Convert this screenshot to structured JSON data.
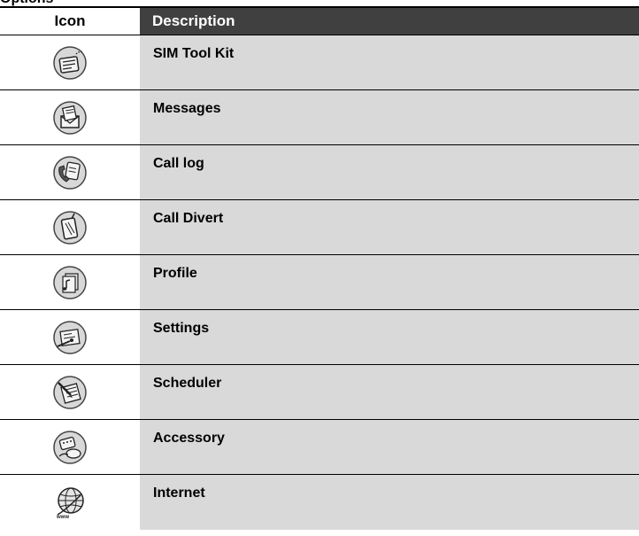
{
  "heading": "Options",
  "table": {
    "header": {
      "icon_col": "Icon",
      "desc_col": "Description"
    },
    "rows": [
      {
        "label": "SIM Tool Kit",
        "icon": "sim-tool-kit-icon"
      },
      {
        "label": "Messages",
        "icon": "messages-icon"
      },
      {
        "label": "Call log",
        "icon": "call-log-icon"
      },
      {
        "label": "Call Divert",
        "icon": "call-divert-icon"
      },
      {
        "label": "Profile",
        "icon": "profile-icon"
      },
      {
        "label": "Settings",
        "icon": "settings-icon"
      },
      {
        "label": "Scheduler",
        "icon": "scheduler-icon"
      },
      {
        "label": "Accessory",
        "icon": "accessory-icon"
      },
      {
        "label": "Internet",
        "icon": "internet-icon"
      }
    ]
  }
}
